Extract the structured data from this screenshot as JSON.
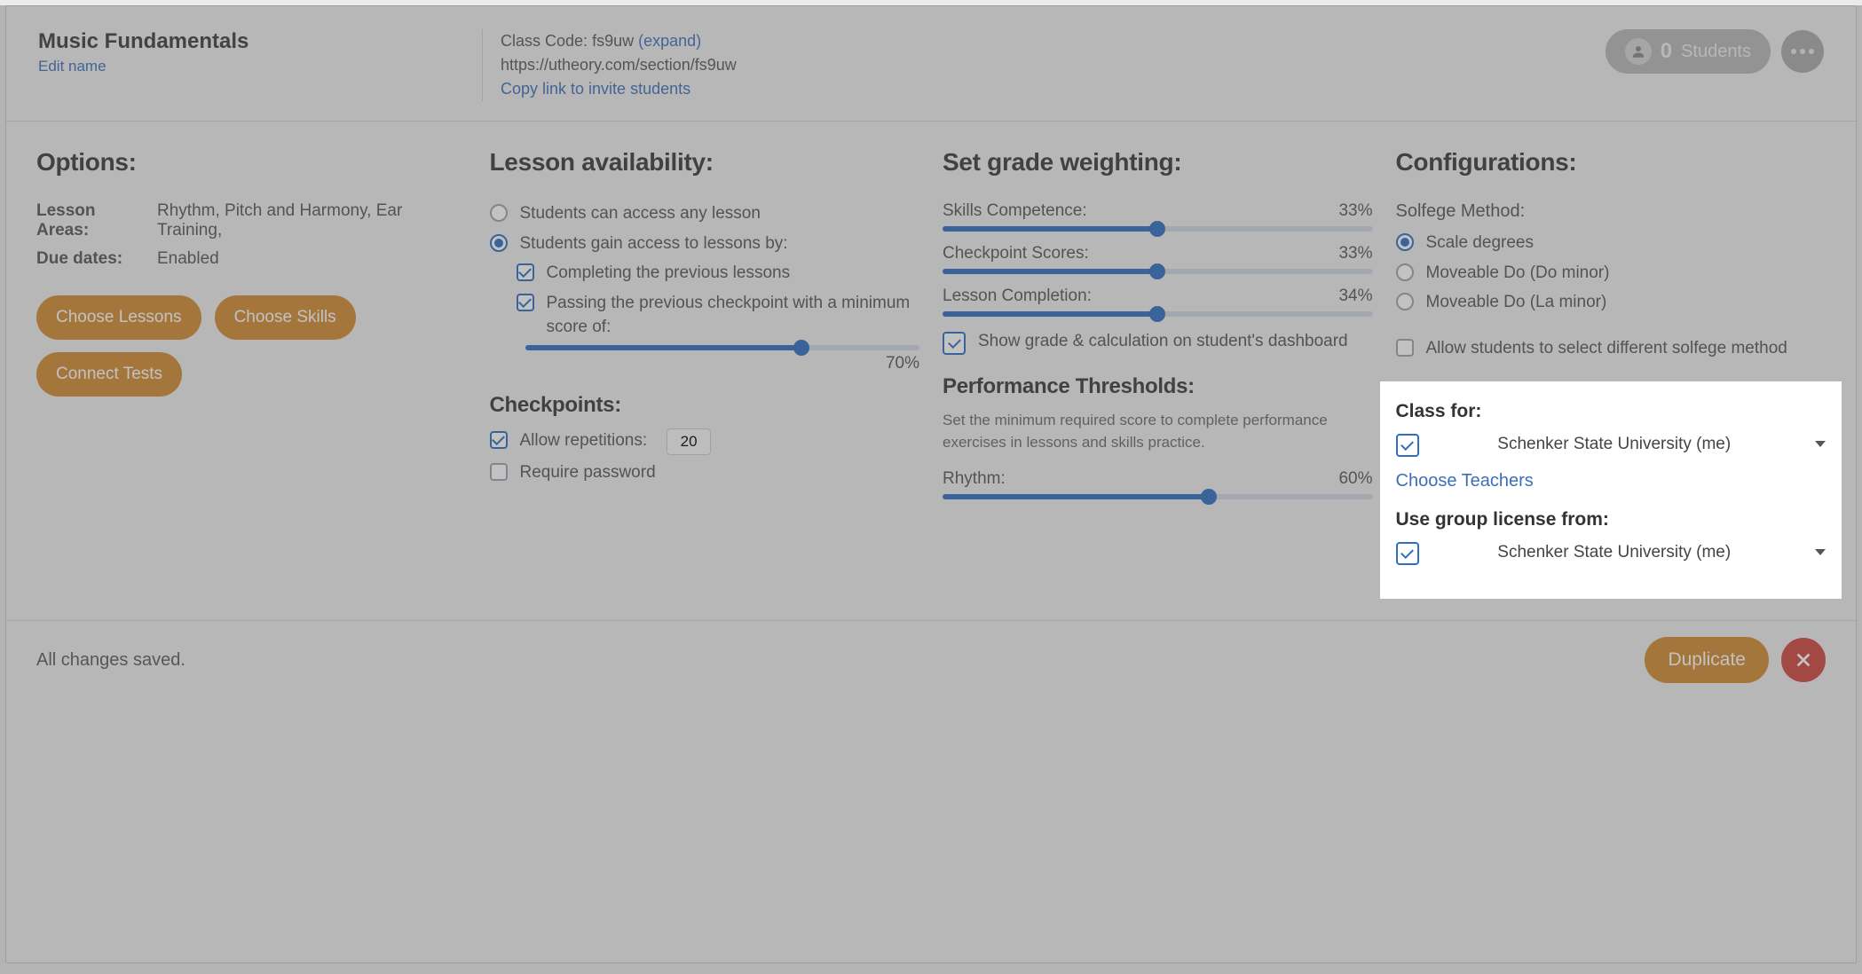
{
  "header": {
    "title": "Music Fundamentals",
    "edit_name": "Edit name",
    "class_code_label": "Class Code:",
    "class_code": "fs9uw",
    "expand": "(expand)",
    "url": "https://utheory.com/section/fs9uw",
    "copy_link": "Copy link to invite students",
    "students_count": "0",
    "students_label": "Students"
  },
  "options": {
    "title": "Options:",
    "lesson_areas_label": "Lesson Areas:",
    "lesson_areas_value": "Rhythm, Pitch and Harmony, Ear Training,",
    "due_dates_label": "Due dates:",
    "due_dates_value": "Enabled",
    "choose_lessons": "Choose Lessons",
    "choose_skills": "Choose Skills",
    "connect_tests": "Connect Tests"
  },
  "availability": {
    "title": "Lesson availability:",
    "any_lesson": "Students can access any lesson",
    "gated": "Students gain access to lessons by:",
    "cond_prev_lessons": "Completing the previous lessons",
    "cond_prev_checkpoint": "Passing the previous checkpoint with a minimum score of:",
    "min_score": "70%",
    "min_score_pct": 70
  },
  "checkpoints": {
    "title": "Checkpoints:",
    "allow_reps": "Allow repetitions:",
    "reps_value": "20",
    "require_password": "Require password"
  },
  "weighting": {
    "title": "Set grade weighting:",
    "skills_label": "Skills Competence:",
    "skills_pct": 33,
    "skills_pct_label": "33%",
    "checkpoint_label": "Checkpoint Scores:",
    "checkpoint_pct": 33,
    "checkpoint_pct_label": "33%",
    "lesson_label": "Lesson Completion:",
    "lesson_pct": 34,
    "lesson_pct_label": "34%",
    "show_dashboard": "Show grade & calculation on student's dashboard"
  },
  "thresholds": {
    "title": "Performance Thresholds:",
    "desc": "Set the minimum required score to complete performance exercises in lessons and skills practice.",
    "rhythm_label": "Rhythm:",
    "rhythm_pct": 60,
    "rhythm_pct_label": "60%"
  },
  "config": {
    "title": "Configurations:",
    "solfege_label": "Solfege Method:",
    "solfege_options": {
      "scale_degrees": "Scale degrees",
      "moveable_do_do": "Moveable Do (Do minor)",
      "moveable_do_la": "Moveable Do (La minor)"
    },
    "allow_student_solfege": "Allow students to select different solfege method",
    "class_for_label": "Class for:",
    "class_for_value": "Schenker State University (me)",
    "choose_teachers": "Choose Teachers",
    "license_label": "Use group license from:",
    "license_value": "Schenker State University (me)"
  },
  "footer": {
    "save_status": "All changes saved.",
    "duplicate": "Duplicate"
  }
}
